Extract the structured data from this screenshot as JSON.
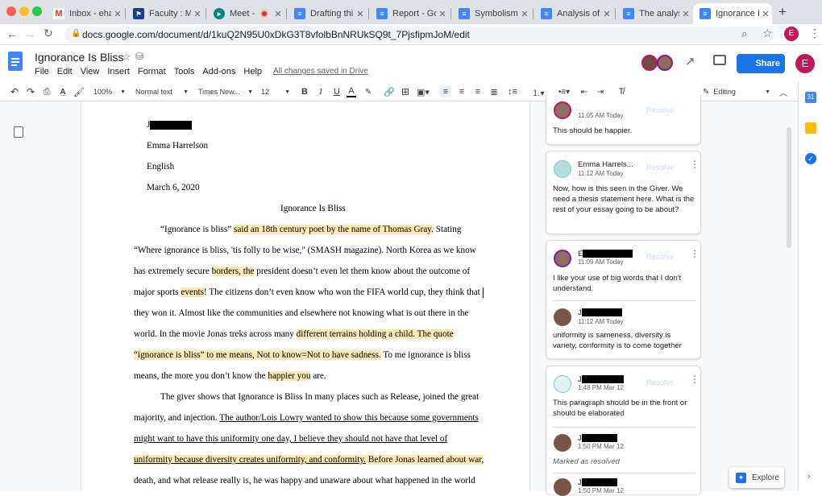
{
  "browser": {
    "tabs": [
      {
        "label": "Inbox - ehar",
        "icon": "gmail-icon"
      },
      {
        "label": "Faculty : My",
        "icon": "faculty-icon"
      },
      {
        "label": "Meet - ",
        "icon": "meet-icon"
      },
      {
        "label": "Drafting thi",
        "icon": "docs-icon"
      },
      {
        "label": "Report - Go",
        "icon": "docs-icon"
      },
      {
        "label": "Symbolism i",
        "icon": "docs-icon"
      },
      {
        "label": "Analysis of",
        "icon": "docs-icon"
      },
      {
        "label": "The analysi",
        "icon": "docs-icon"
      },
      {
        "label": "Ignorance Is",
        "icon": "docs-icon"
      }
    ],
    "url": "docs.google.com/document/d/1kuQ2N95U0xDkG3T8vfolbBnNRUkSQ9t_7PjsfipmJoM/edit",
    "profile_initial": "E"
  },
  "doc": {
    "title": "Ignorance Is Bliss",
    "menu": [
      "File",
      "Edit",
      "View",
      "Insert",
      "Format",
      "Tools",
      "Add-ons",
      "Help"
    ],
    "save_status": "All changes saved in Drive",
    "share_label": "Share",
    "profile_initial": "E"
  },
  "toolbar": {
    "zoom": "100%",
    "style": "Normal text",
    "font": "Times New...",
    "size": "12",
    "mode": "Editing"
  },
  "body": {
    "header_lines": [
      "J",
      "Emma Harrelson",
      "English",
      "March 6, 2020"
    ],
    "title": "Ignorance Is Bliss",
    "p1": [
      [
        "“Ignorance is bliss” ",
        "said an 18th century poet by the name of Thomas Gray.",
        " Stating"
      ],
      [
        "“Where ignorance is bliss, 'tis folly to be wise,\" (SMASH magazine). North Korea as we know"
      ],
      [
        "has extremely secure ",
        "borders, the",
        " president doesn’t even let them know about the outcome of"
      ],
      [
        "major sports ",
        "events",
        "! The citizens don’t even know who won the FIFA world cup, they think that"
      ],
      [
        "they won it. Almost like the communities and elsewhere not knowing what is out there in the"
      ],
      [
        "world. In the movie Jonas treks across many ",
        "different terrains holding a child. The quote"
      ],
      [
        "“ignorance is bliss”  to me means, Not to know=Not to have sadness.",
        " To me ignorance is bliss"
      ],
      [
        "means, the more you don’t know the ",
        "happier you",
        " are",
        "."
      ]
    ],
    "p2": [
      [
        "The giver shows that Ignorance is Bliss In many places such as Release, joined the great"
      ],
      [
        "majority, and injection. ",
        "The author/Lois Lowry wanted to show this because some governments"
      ],
      [
        "might want to have this uniformity one day, I believe they should not have that level of"
      ],
      [
        "uniformity because diversity creates uniformity, and conformity.",
        " Before Jonas learned about war,"
      ],
      [
        "death, and what release really is, he was happy and unaware about what happened in the world"
      ]
    ]
  },
  "comments": [
    {
      "time": "11:05 AM Today",
      "text": "This should be happier.",
      "resolve": "Resolve"
    },
    {
      "name": "Emma Harrels...",
      "time": "11:12 AM Today",
      "text": "Now, how is this seen in the Giver. We need a thesis statement here. What is the rest of your essay going to be about?",
      "resolve": "Resolve"
    },
    {
      "name": "E",
      "time": "11:09 AM Today",
      "text": "I like your use of big words that I don't understand.",
      "resolve": "Resolve",
      "reply": {
        "name": "J",
        "time": "11:12 AM Today",
        "text": "uniformity is sameness, diversity is variety, conformity is to come together"
      }
    },
    {
      "name": "J",
      "time": "1:48 PM Mar 12",
      "text": "This paragraph should be in the front or should be elaborated",
      "resolve": "Resolve",
      "reply": {
        "name": "J",
        "time": "1:50 PM Mar 12",
        "text": "Marked as resolved"
      },
      "reply2": {
        "name": "J",
        "time": "1:50 PM Mar 12"
      }
    }
  ],
  "explore_label": "Explore",
  "colors": {
    "share": "#1a73e8",
    "highlight": "#fce8b2",
    "profile": "#c2185b"
  }
}
